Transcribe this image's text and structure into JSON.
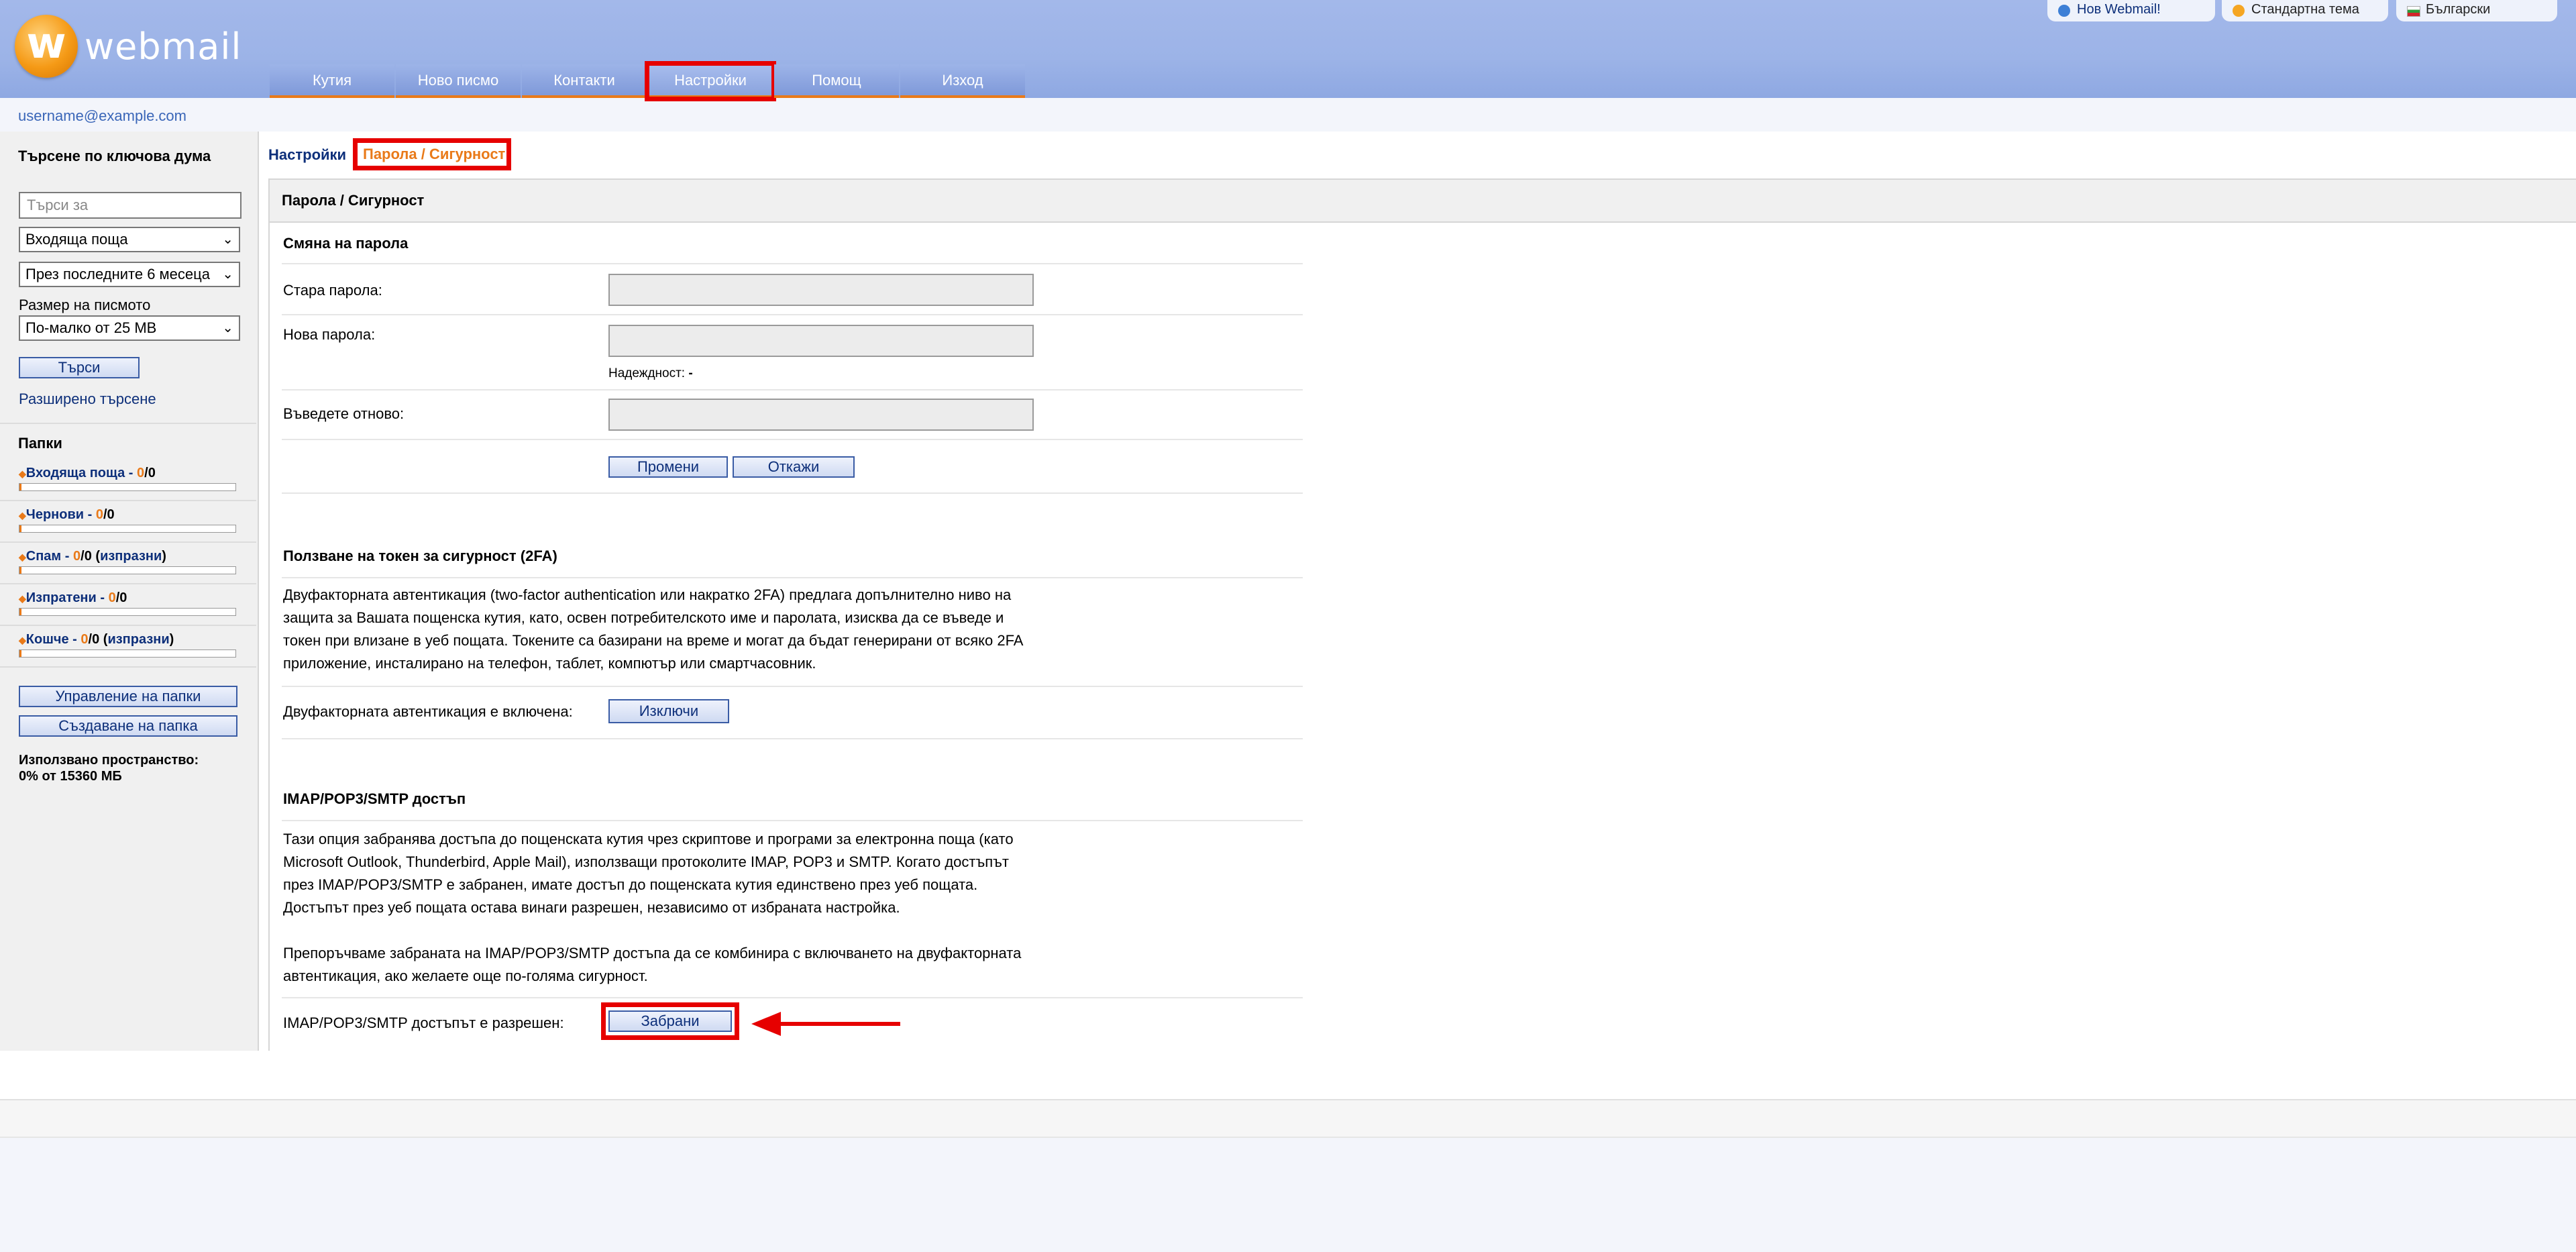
{
  "app": {
    "logo_text": "webmail",
    "logo_letter": "w"
  },
  "top_links": [
    {
      "label": "Нов Webmail!",
      "icon": "webmail-icon"
    },
    {
      "label": "Стандартна тема",
      "icon": "theme-icon"
    },
    {
      "label": "Български",
      "icon": "bulgarian-flag-icon"
    }
  ],
  "nav": {
    "tabs": [
      "Кутия",
      "Ново писмо",
      "Контакти",
      "Настройки",
      "Помощ",
      "Изход"
    ],
    "active": "Настройки"
  },
  "user": {
    "email": "username@example.com"
  },
  "sidebar": {
    "search_title": "Търсене по ключова дума",
    "search_placeholder": "Търси за",
    "folder_select": "Входяща поща",
    "period_select": "През последните 6 месеца",
    "size_label": "Размер на писмото",
    "size_select": "По-малко от 25 MB",
    "search_button": "Търси",
    "advanced_search": "Разширено търсене",
    "folders_title": "Папки",
    "folders": [
      {
        "name": "Входяща поща",
        "unread": "0",
        "total": "0",
        "empty_link": ""
      },
      {
        "name": "Чернови",
        "unread": "0",
        "total": "0",
        "empty_link": ""
      },
      {
        "name": "Спам",
        "unread": "0",
        "total": "0",
        "empty_link": "изпразни"
      },
      {
        "name": "Изпратени",
        "unread": "0",
        "total": "0",
        "empty_link": ""
      },
      {
        "name": "Кошче",
        "unread": "0",
        "total": "0",
        "empty_link": "изпразни"
      }
    ],
    "manage_folders_button": "Управление на папки",
    "create_folder_button": "Създаване на папка",
    "used_space_label": "Използвано пространство:",
    "used_space_value": "0% от 15360 МБ"
  },
  "breadcrumb": {
    "root": "Настройки",
    "current": "Парола / Сигурност"
  },
  "panel": {
    "title": "Парола / Сигурност",
    "password": {
      "heading": "Смяна на парола",
      "old_label": "Стара парола:",
      "new_label": "Нова парола:",
      "strength_label": "Надеждност:",
      "strength_value": "-",
      "repeat_label": "Въведете отново:",
      "change_button": "Промени",
      "cancel_button": "Откажи"
    },
    "twofa": {
      "heading": "Ползване на токен за сигурност (2FA)",
      "lines": [
        "Двуфакторната автентикация (two-factor authentication или накратко 2FA) предлага допълнително ниво на",
        "защита за Вашата пощенска кутия, като, освен потребителското име и паролата, изисква да се въведе и",
        "токен при влизане в уеб пощата. Токените са базирани на време и могат да бъдат генерирани от всяко 2FA",
        "приложение, инсталирано на телефон, таблет, компютър или смартчасовник."
      ],
      "status_label": "Двуфакторната автентикация е включена:",
      "toggle_button": "Изключи"
    },
    "imap": {
      "heading": "IMAP/POP3/SMTP достъп",
      "lines": [
        "Тази опция забранява достъпа до пощенската кутия чрез скриптове и програми за електронна поща (като",
        "Microsoft Outlook, Thunderbird, Apple Mail), използващи протоколите IMAP, POP3 и SMTP. Когато достъпът",
        "през IMAP/POP3/SMTP е забранен, имате достъп до пощенската кутия единствено през уеб пощата.",
        "Достъпът през уеб пощата остава винаги разрешен, независимо от избраната настройка."
      ],
      "lines2": [
        "Препоръчваме забраната на IMAP/POP3/SMTP достъпа да се комбинира с включването на двуфакторната",
        "автентикация, ако желаете още по-голяма сигурност."
      ],
      "status_label": "IMAP/POP3/SMTP достъпът е разрешен:",
      "toggle_button": "Забрани"
    }
  },
  "colors": {
    "accent": "#e97a19",
    "highlight": "#e60000",
    "link": "#0d2f7a"
  }
}
